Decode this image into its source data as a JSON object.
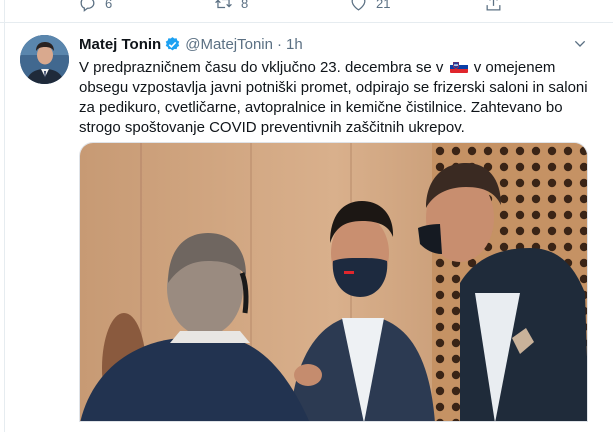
{
  "prev_tweet": {
    "reply_count": "6",
    "retweet_count": "8",
    "like_count": "21"
  },
  "tweet": {
    "author_name": "Matej Tonin",
    "handle": "@MatejTonin",
    "separator": "·",
    "time": "1h",
    "text_part1": "V predprazničnem času do vključno 23. decembra se v",
    "text_part2": " v omejenem obsegu vzpostavlja javni potniški promet, odpirajo se frizerski saloni in saloni za pedikuro, cvetličarne, avtopralnice in kemične čistilnice. Zahtevano bo strogo spoštovanje COVID preventivnih zaščitnih ukrepov.",
    "flag_emoji": "slovenia-flag",
    "verified": true
  },
  "icons": {
    "reply": "reply-icon",
    "retweet": "retweet-icon",
    "like": "heart-icon",
    "share": "share-icon",
    "caret": "chevron-down-icon",
    "verified": "verified-badge-icon"
  },
  "colors": {
    "accent": "#1da1f2",
    "muted": "#5b7083",
    "text": "#0f1419",
    "border": "#e6ecf0"
  }
}
